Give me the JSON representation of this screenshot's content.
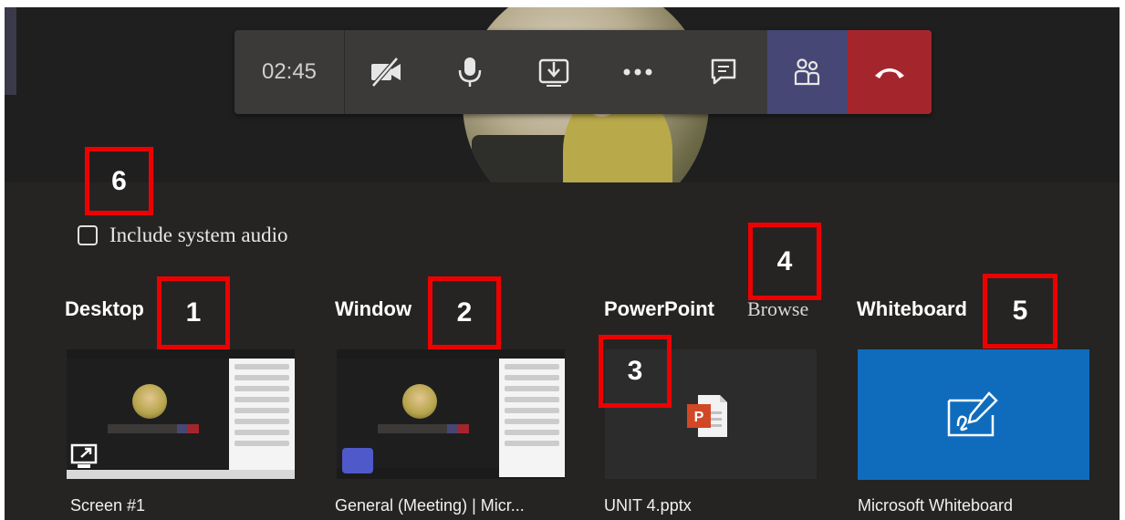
{
  "call_toolbar": {
    "timer": "02:45"
  },
  "share_panel": {
    "include_audio_label": "Include system audio",
    "sections": {
      "desktop": {
        "title": "Desktop",
        "item_label": "Screen #1"
      },
      "window": {
        "title": "Window",
        "item_label": "General (Meeting) | Micr..."
      },
      "powerpoint": {
        "title": "PowerPoint",
        "browse_label": "Browse",
        "item_label": "UNIT 4.pptx"
      },
      "whiteboard": {
        "title": "Whiteboard",
        "item_label": "Microsoft Whiteboard"
      }
    }
  },
  "annotations": {
    "n1": "1",
    "n2": "2",
    "n3": "3",
    "n4": "4",
    "n5": "5",
    "n6": "6"
  },
  "colors": {
    "background": "#201f1f",
    "toolbar": "#3b3a39",
    "people_button": "#464775",
    "hangup_button": "#a4262c",
    "whiteboard_tile": "#0f6cbd",
    "annotation_border": "#ee0000"
  },
  "icons": [
    "camera-off-icon",
    "microphone-icon",
    "share-tray-icon",
    "more-options-icon",
    "chat-icon",
    "participants-icon",
    "hang-up-icon",
    "powerpoint-file-icon",
    "whiteboard-icon",
    "share-screen-icon",
    "teams-logo"
  ]
}
